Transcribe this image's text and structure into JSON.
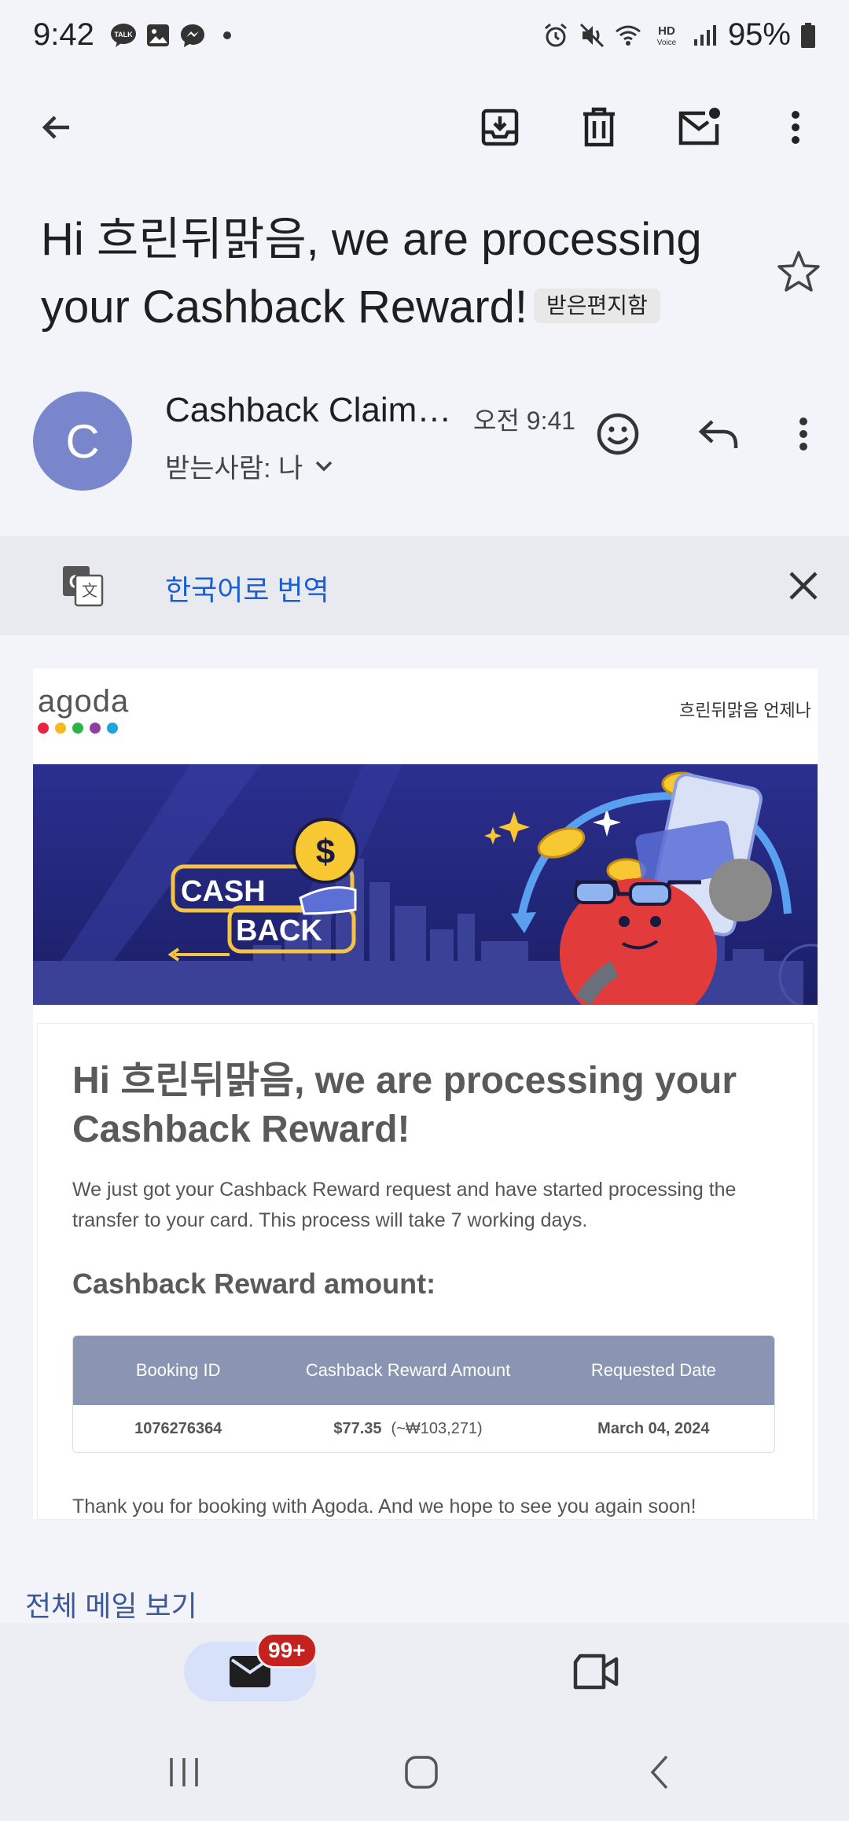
{
  "status_bar": {
    "time": "9:42",
    "battery": "95%",
    "left_icons": [
      "talk-icon",
      "gallery-icon",
      "messenger-icon",
      "dot-icon"
    ],
    "right_icons": [
      "alarm-icon",
      "mute-icon",
      "wifi-icon",
      "hd-voice-icon",
      "signal-icon",
      "battery-icon"
    ]
  },
  "toolbar": {
    "back": "back-arrow-icon",
    "actions": [
      "archive-icon",
      "delete-icon",
      "mark-unread-icon",
      "more-vert-icon"
    ]
  },
  "email": {
    "subject": "Hi 흐린뒤맑음, we are processing your Cashback Reward!",
    "label": "받은편지함",
    "sender_initial": "C",
    "sender_name": "Cashback Claim…",
    "time": "오전 9:41",
    "recipients": "받는사람: 나"
  },
  "translate": {
    "text": "한국어로 번역"
  },
  "body": {
    "logo_text": "agoda",
    "logo_colors": [
      "#e8243f",
      "#f7b922",
      "#2cb34a",
      "#8e3f9f",
      "#1ea6dc"
    ],
    "header_right": "흐린뒤맑음 언제나",
    "banner_cash": "CASH",
    "banner_back": "BACK",
    "title": "Hi 흐린뒤맑음, we are processing your Cashback Reward!",
    "paragraph": "We just got your Cashback Reward request and have started processing the transfer to your card. This process will take 7 working days.",
    "subheading": "Cashback Reward amount:",
    "table": {
      "headers": [
        "Booking ID",
        "Cashback Reward Amount",
        "Requested Date"
      ],
      "row": {
        "booking_id": "1076276364",
        "amount": "$77.35",
        "amount_krw": "(~₩103,271)",
        "date": "March 04, 2024"
      }
    },
    "thanks": "Thank you for booking with Agoda. And we hope to see you again soon!"
  },
  "view_all": "전체 메일 보기",
  "bottom_nav": {
    "badge": "99+"
  },
  "colors": {
    "accent": "#1a5fd0",
    "avatar": "#7986cb",
    "table_header": "#8a95b3",
    "badge": "#c5221f"
  }
}
